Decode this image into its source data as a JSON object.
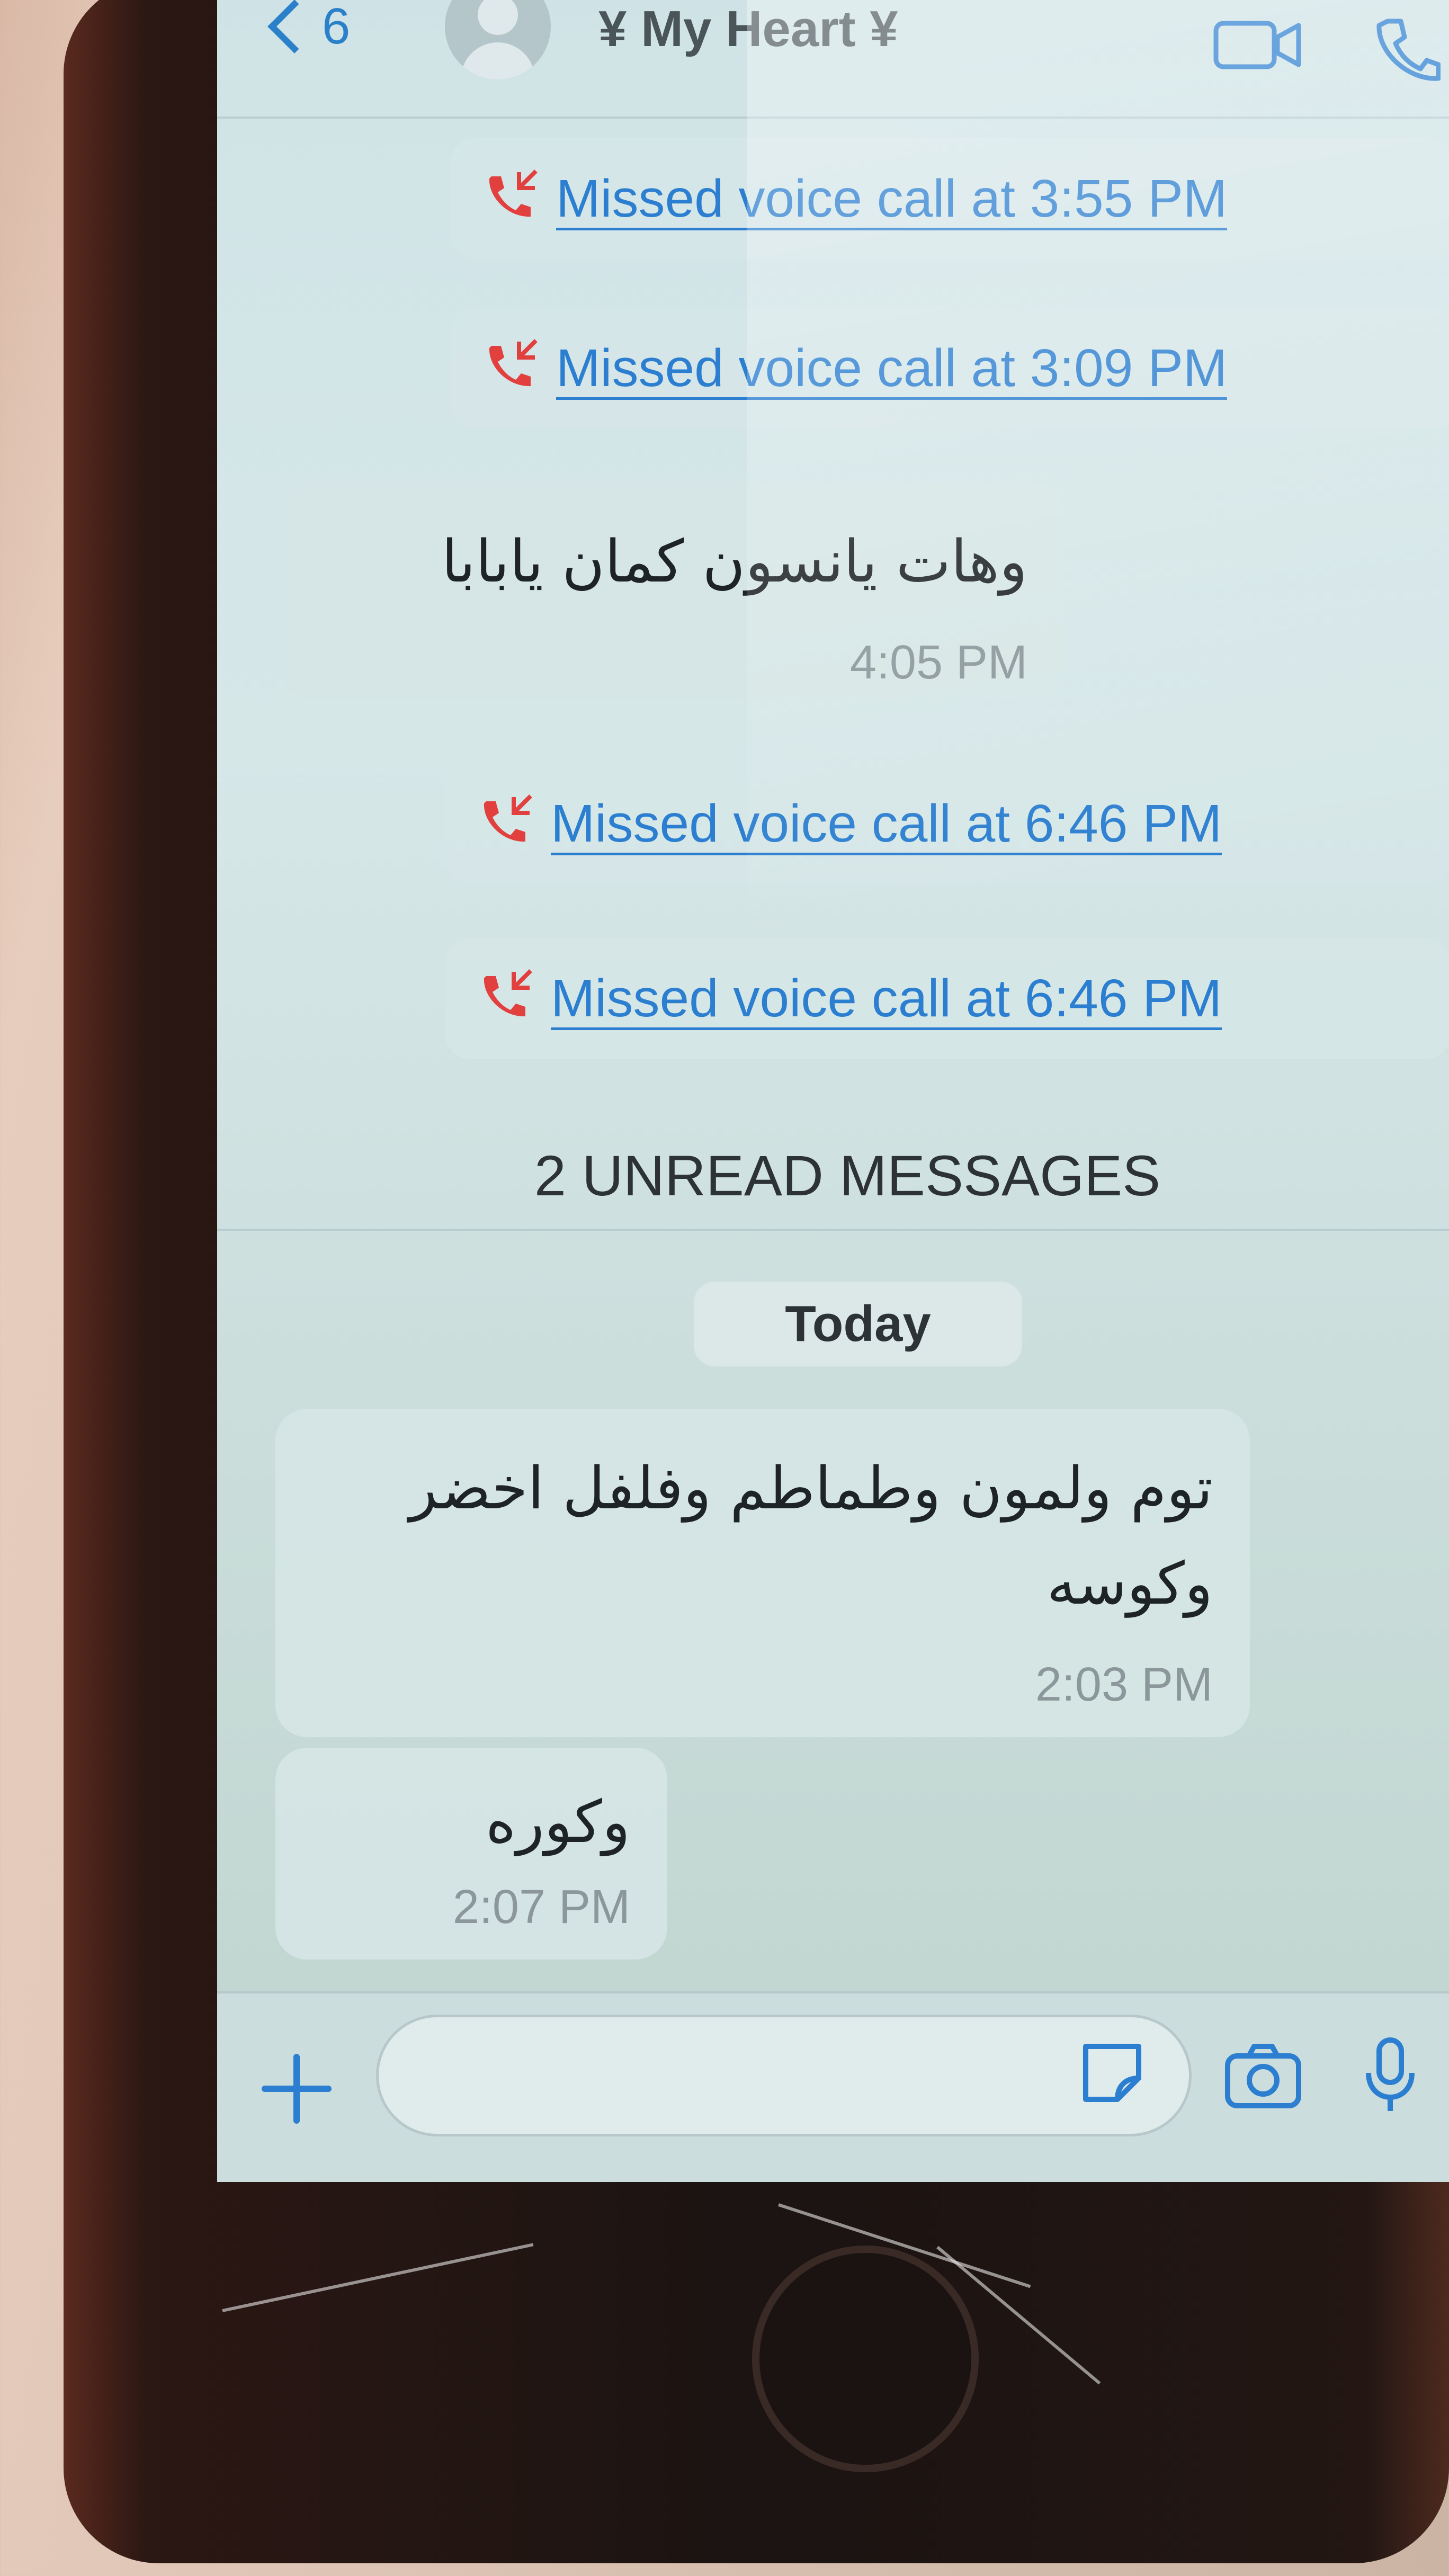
{
  "header": {
    "back_count": "6",
    "contact_name": "¥ My Heart ¥",
    "icons": [
      "video-call-icon",
      "voice-call-icon"
    ]
  },
  "messages": {
    "missed_calls_top": [
      "Missed voice call at 3:55 PM",
      "Missed voice call at 3:09 PM"
    ],
    "text_1": {
      "body": "وهات يانسون كمان يابابا",
      "time": "4:05 PM"
    },
    "missed_calls_mid": [
      "Missed voice call at 6:46 PM",
      "Missed voice call at 6:46 PM"
    ],
    "unread_banner": "2 UNREAD MESSAGES",
    "date_pill": "Today",
    "text_2": {
      "line1": "توم ولمون وطماطم وفلفل اخضر",
      "line2": "وكوسه",
      "time": "2:03 PM"
    },
    "text_3": {
      "body": "وكوره",
      "time": "2:07 PM"
    }
  },
  "input_bar": {
    "placeholder": "",
    "icons": [
      "plus-icon",
      "sticker-icon",
      "camera-icon",
      "microphone-icon"
    ]
  },
  "colors": {
    "accent": "#2c7fd0",
    "missed_call": "#e2403f",
    "bubble": "#d6e6e6",
    "timestamp": "#8b979b"
  }
}
